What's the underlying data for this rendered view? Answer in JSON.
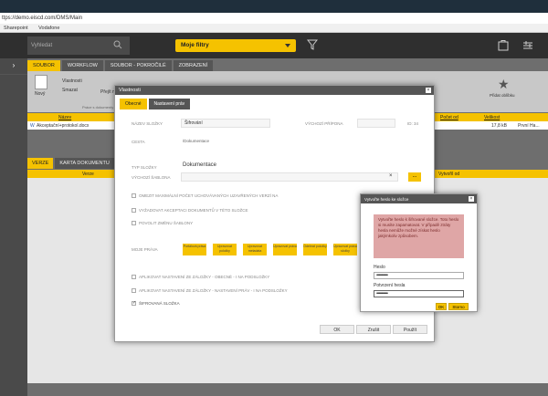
{
  "browser": {
    "url": "ttps://demo.eiscd.com/DMS/Main",
    "bookmarks": [
      "Sharepoint",
      "Vodafone"
    ]
  },
  "app": {
    "search_placeholder": "Vyhledat",
    "filter_label": "Moje filtry",
    "tabs": [
      "SOUBOR",
      "WORKFLOW",
      "SOUBOR - POKROČILÉ",
      "ZOBRAZENÍ"
    ],
    "ribbon": {
      "new_label": "Nový",
      "properties": "Vlastnosti",
      "delete": "Smazat",
      "move": "Přejít na",
      "favorite": "Přidat oblíbku",
      "group_label": "Práce s dokumenty"
    },
    "list": {
      "col_name": "Název",
      "col_count": "Počet od",
      "col_size": "Velikost",
      "row_name": "Akceptační+protokol.docx",
      "row_size": "17,8 kB",
      "row_user": "První Ha..."
    },
    "verze_tabs": [
      "VERZE",
      "KARTA DOKUMENTU"
    ],
    "verze_col": "Verze",
    "verze_col2": "Vytvořil od"
  },
  "properties_modal": {
    "title": "Vlastnosti",
    "tabs": [
      "Obecné",
      "Nastavení práv"
    ],
    "name_label": "NÁZEV SLOŽKY",
    "name_value": "Šifrování",
    "ext_label": "VÝCHOZÍ PŘÍPONA",
    "id_value": "ID: 34",
    "path_label": "CESTA",
    "path_value": "/Dokumentace",
    "type_label": "TYP SLOŽKY",
    "type_value": "Dokumentace",
    "template_label": "VÝCHOZÍ ŠABLONA",
    "clear_symbol": "×",
    "browse_symbol": "...",
    "checks": [
      {
        "label": "OMEZIT MAXIMÁLNÍ POČET UCHOVÁVANÝCH UZAVŘENÝCH VERZÍ NA",
        "checked": false
      },
      {
        "label": "VYŽADOVAT AKCEPTACI DOKUMENTŮ V TÉTO SLOŽCE",
        "checked": false
      },
      {
        "label": "POVOLIT ZMĚNU ŠABLONY",
        "checked": false
      }
    ],
    "rights_label": "MOJE PRÁVA",
    "rights": [
      "Portálová práva",
      "Upravovat položky",
      "Upravovat metadata",
      "Upravovat práva",
      "Odebrat položky",
      "Upravovat práva složky"
    ],
    "bottom_checks": [
      {
        "label": "APLIKOVAT NASTAVENÍ ZE ZÁLOŽKY - OBECNÉ - I NA PODSLOŽKY",
        "checked": false
      },
      {
        "label": "APLIKOVAT NASTAVENÍ ZE ZÁLOŽKY - NASTAVENÍ PRÁV - I NA PODSLOŽKY",
        "checked": false
      },
      {
        "label": "ŠIFROVANÁ SLOŽKA",
        "checked": true
      }
    ],
    "buttons": {
      "ok": "OK",
      "cancel": "Zrušit",
      "apply": "Použít"
    }
  },
  "password_dialog": {
    "title": "Vytvořte heslo ke složce",
    "warning": "Vytvořte heslo k šifrované složce. Toto heslo si musíte zapamatovat. V případě ztráty hesla nemůže možné získat heslo jakýmkoliv způsobem.",
    "password_label": "Heslo",
    "password_value": "••••••••••••••••",
    "confirm_label": "Potvrzení hesla",
    "confirm_value": "••••••••••••••••",
    "ok": "OK",
    "cancel": "Storno"
  },
  "colors": {
    "accent": "#f5c200",
    "dark": "#2f2f2f",
    "warning_bg": "#dfa6a6"
  }
}
